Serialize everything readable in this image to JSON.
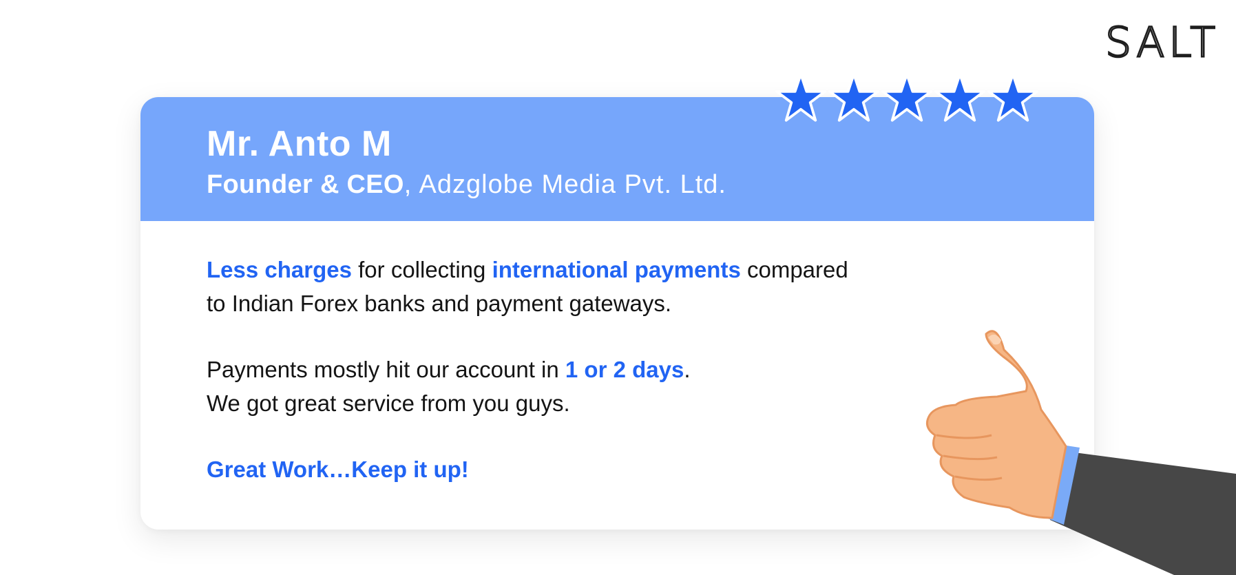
{
  "brand": {
    "logo_text": "SALT"
  },
  "rating": {
    "value": 5,
    "max": 5,
    "star_color": "#2164f3"
  },
  "testimonial": {
    "name": "Mr. Anto M",
    "role": "Founder & CEO",
    "company": "Adzglobe Media Pvt. Ltd.",
    "paragraph1": {
      "highlight1": "Less charges",
      "text1": " for collecting ",
      "highlight2": "international payments",
      "text2": " compared",
      "line2": "to Indian Forex banks and payment gateways."
    },
    "paragraph2": {
      "text1": "Payments mostly hit our account in ",
      "highlight": "1 or 2 days",
      "text2": ".",
      "line2": "We got great service from you guys."
    },
    "closing": "Great Work…Keep it up!"
  },
  "colors": {
    "header_bg": "#76a6fb",
    "accent": "#2164f3",
    "body_text": "#141414"
  },
  "illustration": {
    "icon": "thumbs-up-icon"
  }
}
